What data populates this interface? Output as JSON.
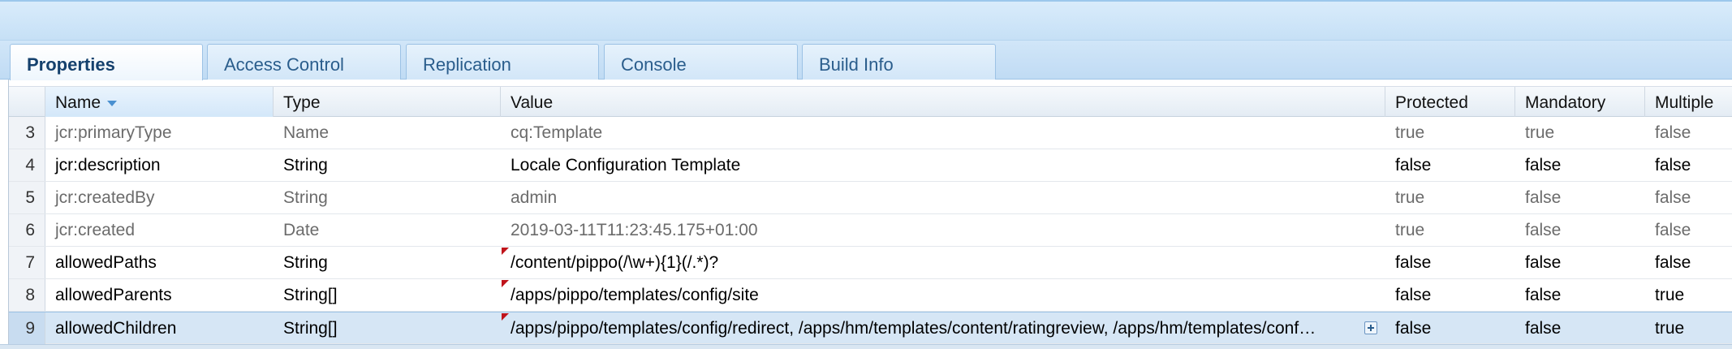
{
  "tabs": [
    {
      "label": "Properties",
      "active": true
    },
    {
      "label": "Access Control",
      "active": false
    },
    {
      "label": "Replication",
      "active": false
    },
    {
      "label": "Console",
      "active": false
    },
    {
      "label": "Build Info",
      "active": false
    }
  ],
  "grid": {
    "columns": [
      "Name",
      "Type",
      "Value",
      "Protected",
      "Mandatory",
      "Multiple"
    ],
    "sort_column": "Name",
    "sort_direction": "descending",
    "rows": [
      {
        "num": "3",
        "name": "jcr:primaryType",
        "type": "Name",
        "value": "cq:Template",
        "protected": "true",
        "mandatory": "true",
        "multiple": "false",
        "protected_row": true,
        "modified": false
      },
      {
        "num": "4",
        "name": "jcr:description",
        "type": "String",
        "value": "Locale Configuration Template",
        "protected": "false",
        "mandatory": "false",
        "multiple": "false",
        "protected_row": false,
        "modified": false
      },
      {
        "num": "5",
        "name": "jcr:createdBy",
        "type": "String",
        "value": "admin",
        "protected": "true",
        "mandatory": "false",
        "multiple": "false",
        "protected_row": true,
        "modified": false
      },
      {
        "num": "6",
        "name": "jcr:created",
        "type": "Date",
        "value": "2019-03-11T11:23:45.175+01:00",
        "protected": "true",
        "mandatory": "false",
        "multiple": "false",
        "protected_row": true,
        "modified": false
      },
      {
        "num": "7",
        "name": "allowedPaths",
        "type": "String",
        "value": "/content/pippo(/\\w+){1}(/.*)?",
        "protected": "false",
        "mandatory": "false",
        "multiple": "false",
        "protected_row": false,
        "modified": true
      },
      {
        "num": "8",
        "name": "allowedParents",
        "type": "String[]",
        "value": "/apps/pippo/templates/config/site",
        "protected": "false",
        "mandatory": "false",
        "multiple": "true",
        "protected_row": false,
        "modified": true
      },
      {
        "num": "9",
        "name": "allowedChildren",
        "type": "String[]",
        "value": "/apps/pippo/templates/config/redirect, /apps/hm/templates/content/ratingreview, /apps/hm/templates/conf…",
        "protected": "false",
        "mandatory": "false",
        "multiple": "true",
        "protected_row": false,
        "modified": true,
        "selected": true
      }
    ]
  },
  "icons": {
    "sort": "sort-desc-icon",
    "expand": "expand-plus-icon",
    "modified": "modified-marker-icon"
  },
  "colors": {
    "accent": "#4a90d0",
    "selected_row": "#d6e6f5",
    "modified_marker": "#c0141b",
    "tab_text": "#2a5d8c"
  }
}
